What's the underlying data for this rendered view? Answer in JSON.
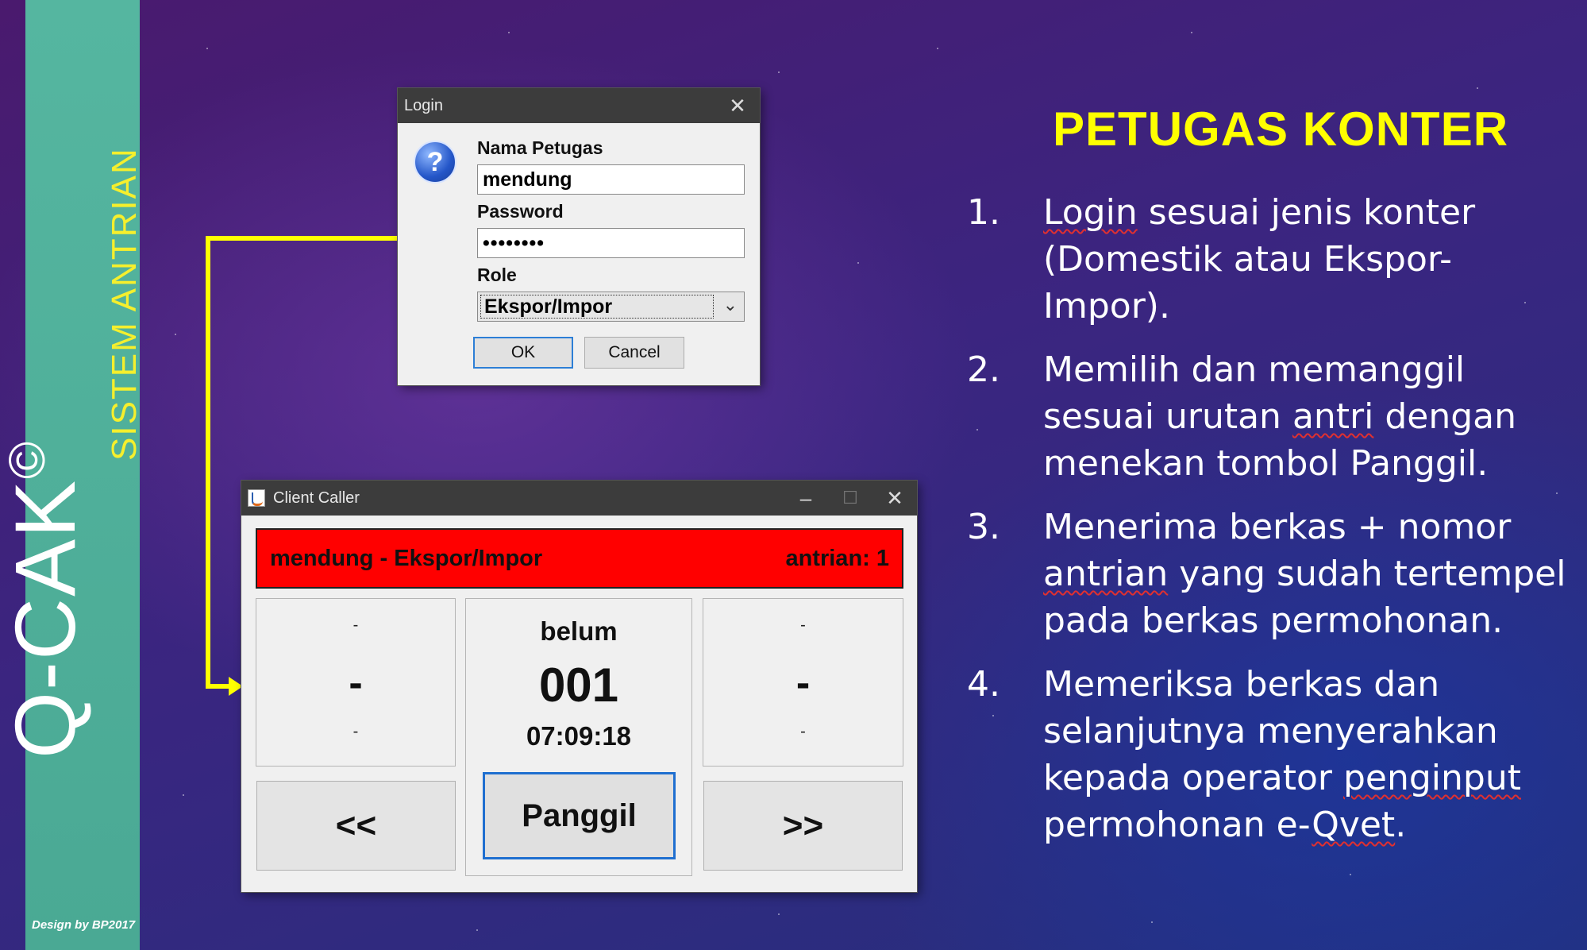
{
  "sidebar": {
    "brand": "Q-CAK",
    "brand_mark": "©",
    "subtitle": "SISTEM ANTRIAN",
    "credit": "Design by BP2017"
  },
  "login_dialog": {
    "title": "Login",
    "close_label": "✕",
    "help_glyph": "?",
    "name_label": "Nama Petugas",
    "name_value": "mendung",
    "password_label": "Password",
    "password_value": "••••••••",
    "role_label": "Role",
    "role_value": "Ekspor/Impor",
    "ok_label": "OK",
    "cancel_label": "Cancel"
  },
  "client_caller": {
    "title": "Client Caller",
    "status_left": "mendung - Ekspor/Impor",
    "status_right": "antrian:  1",
    "left_panel": {
      "top": "-",
      "main": "-",
      "bottom": "-"
    },
    "center_panel": {
      "status": "belum",
      "number": "001",
      "time": "07:09:18"
    },
    "right_panel": {
      "top": "-",
      "main": "-",
      "bottom": "-"
    },
    "prev_label": "<<",
    "call_label": "Panggil",
    "next_label": ">>"
  },
  "instructions": {
    "heading": "PETUGAS KONTER",
    "steps": [
      {
        "num": "1.",
        "pre": "",
        "u1": "Login",
        "mid": " sesuai jenis konter (Domestik atau Ekspor-Impor).",
        "u2": "",
        "post": ""
      },
      {
        "num": "2.",
        "pre": "Memilih dan memanggil sesuai urutan ",
        "u1": "antri",
        "mid": " dengan menekan tombol Panggil.",
        "u2": "",
        "post": ""
      },
      {
        "num": "3.",
        "pre": "Menerima berkas + nomor ",
        "u1": "antrian",
        "mid": " yang sudah tertempel pada berkas permohonan.",
        "u2": "",
        "post": ""
      },
      {
        "num": "4.",
        "pre": "Memeriksa berkas dan selanjutnya menyerahkan kepada operator ",
        "u1": "penginput",
        "mid": " permohonan e-",
        "u2": "Qvet",
        "post": "."
      }
    ]
  },
  "colors": {
    "sidebar": "#4aa994",
    "accent_yellow": "#ffff00",
    "status_red": "#ff0000"
  }
}
